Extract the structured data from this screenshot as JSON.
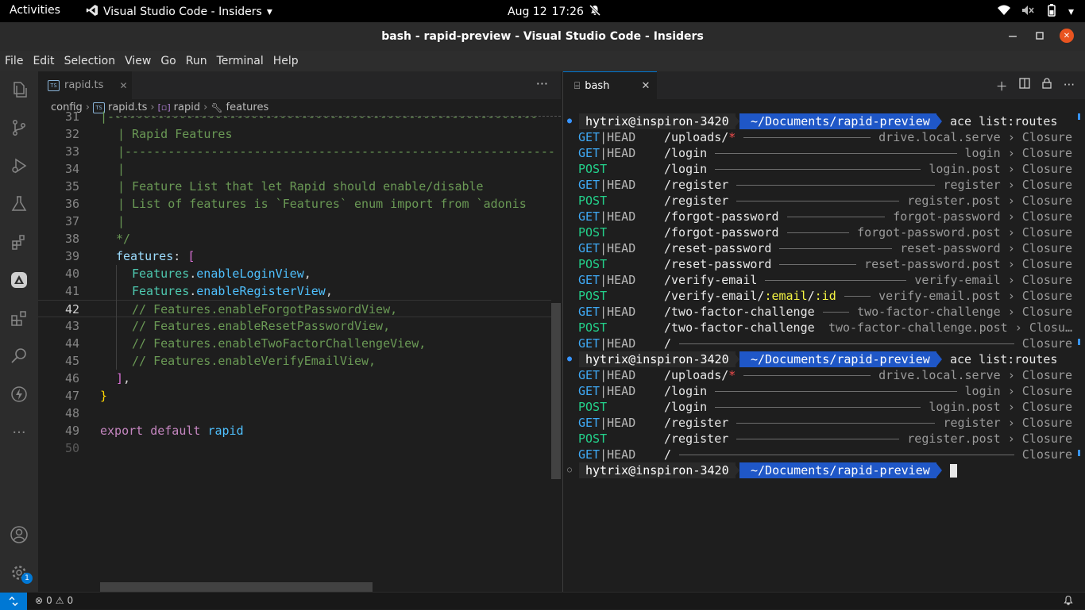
{
  "topbar": {
    "activities": "Activities",
    "app_name": "Visual Studio Code - Insiders",
    "date": "Aug 12",
    "time": "17:26"
  },
  "window": {
    "title": "bash - rapid-preview - Visual Studio Code - Insiders"
  },
  "menu": [
    "File",
    "Edit",
    "Selection",
    "View",
    "Go",
    "Run",
    "Terminal",
    "Help"
  ],
  "activitybar": {
    "icons": [
      "explorer-icon",
      "source-control-icon",
      "run-debug-icon",
      "testing-icon",
      "extensions-icon",
      "adonis-icon",
      "remote-explorer-icon",
      "search-icon",
      "thunder-icon",
      "more-icon"
    ],
    "accounts_icon": "account-icon",
    "settings_badge": "1"
  },
  "editor": {
    "tab_label": "rapid.ts",
    "breadcrumb": [
      "config",
      "rapid.ts",
      "rapid",
      "features"
    ],
    "lines": [
      {
        "n": "31",
        "text": ""
      },
      {
        "n": "32",
        "text": "| Rapid Features"
      },
      {
        "n": "33",
        "text": "|------------------------------------------------------------"
      },
      {
        "n": "34",
        "text": "|"
      },
      {
        "n": "35",
        "text": "| Feature List that let Rapid should enable/disable"
      },
      {
        "n": "36",
        "text": "| List of features is `Features` enum import from `adonis"
      },
      {
        "n": "37",
        "text": "|"
      },
      {
        "n": "38",
        "text": "*/"
      },
      {
        "n": "39",
        "text": ""
      },
      {
        "n": "40",
        "text": ""
      },
      {
        "n": "41",
        "text": ""
      },
      {
        "n": "42",
        "text": "// Features.enableForgotPasswordView,"
      },
      {
        "n": "43",
        "text": "// Features.enableResetPasswordView,"
      },
      {
        "n": "44",
        "text": "// Features.enableTwoFactorChallengeView,"
      },
      {
        "n": "45",
        "text": "// Features.enableVerifyEmailView,"
      },
      {
        "n": "46",
        "text": ""
      },
      {
        "n": "47",
        "text": "}"
      },
      {
        "n": "48",
        "text": ""
      },
      {
        "n": "49",
        "text": ""
      },
      {
        "n": "50",
        "text": ""
      }
    ],
    "tokens": {
      "features_key": "features",
      "colon": ":",
      "open_bracket": "[",
      "close_bracket": "]",
      "comma": ",",
      "cls": "Features",
      "dot": ".",
      "fn_login": "enableLoginView",
      "fn_register": "enableRegisterView",
      "export_kw": "export default",
      "export_var": "rapid"
    }
  },
  "terminal": {
    "tab_label": "bash",
    "user_host": "hytrix@inspiron-3420",
    "cwd": "~/Documents/rapid-preview",
    "command": "ace list:routes",
    "routes_a": [
      {
        "m1": "GET",
        "m2": "HEAD",
        "path": "/uploads/",
        "star": "*",
        "handler": "drive.local.serve",
        "arrow": " › ",
        "closure": "Closure"
      },
      {
        "m1": "GET",
        "m2": "HEAD",
        "path": "/login",
        "handler": "login",
        "arrow": " › ",
        "closure": "Closure"
      },
      {
        "m1": "POST",
        "m2": "",
        "path": "/login",
        "handler": "login.post",
        "arrow": " › ",
        "closure": "Closure"
      },
      {
        "m1": "GET",
        "m2": "HEAD",
        "path": "/register",
        "handler": "register",
        "arrow": " › ",
        "closure": "Closure"
      },
      {
        "m1": "POST",
        "m2": "",
        "path": "/register",
        "handler": "register.post",
        "arrow": " › ",
        "closure": "Closure"
      },
      {
        "m1": "GET",
        "m2": "HEAD",
        "path": "/forgot-password",
        "handler": "forgot-password",
        "arrow": " › ",
        "closure": "Closure"
      },
      {
        "m1": "POST",
        "m2": "",
        "path": "/forgot-password",
        "handler": "forgot-password.post",
        "arrow": " › ",
        "closure": "Closure"
      },
      {
        "m1": "GET",
        "m2": "HEAD",
        "path": "/reset-password",
        "handler": "reset-password",
        "arrow": " › ",
        "closure": "Closure"
      },
      {
        "m1": "POST",
        "m2": "",
        "path": "/reset-password",
        "handler": "reset-password.post",
        "arrow": " › ",
        "closure": "Closure"
      },
      {
        "m1": "GET",
        "m2": "HEAD",
        "path": "/verify-email",
        "handler": "verify-email",
        "arrow": " › ",
        "closure": "Closure"
      },
      {
        "m1": "POST",
        "m2": "",
        "path": "/verify-email/",
        "p1": ":email",
        "slash": "/",
        "p2": ":id",
        "handler": "verify-email.post",
        "arrow": " › ",
        "closure": "Closure"
      },
      {
        "m1": "GET",
        "m2": "HEAD",
        "path": "/two-factor-challenge",
        "handler": "two-factor-challenge",
        "arrow": " › ",
        "closure": "Closure"
      },
      {
        "m1": "POST",
        "m2": "",
        "path": "/two-factor-challenge",
        "handler": "two-factor-challenge.post",
        "arrow": " › ",
        "closure": "Closu…"
      },
      {
        "m1": "GET",
        "m2": "HEAD",
        "path": "/",
        "handler": "",
        "arrow": "",
        "closure": "Closure"
      }
    ],
    "routes_b": [
      {
        "m1": "GET",
        "m2": "HEAD",
        "path": "/uploads/",
        "star": "*",
        "handler": "drive.local.serve",
        "arrow": " › ",
        "closure": "Closure"
      },
      {
        "m1": "GET",
        "m2": "HEAD",
        "path": "/login",
        "handler": "login",
        "arrow": " › ",
        "closure": "Closure"
      },
      {
        "m1": "POST",
        "m2": "",
        "path": "/login",
        "handler": "login.post",
        "arrow": " › ",
        "closure": "Closure"
      },
      {
        "m1": "GET",
        "m2": "HEAD",
        "path": "/register",
        "handler": "register",
        "arrow": " › ",
        "closure": "Closure"
      },
      {
        "m1": "POST",
        "m2": "",
        "path": "/register",
        "handler": "register.post",
        "arrow": " › ",
        "closure": "Closure"
      },
      {
        "m1": "GET",
        "m2": "HEAD",
        "path": "/",
        "handler": "",
        "arrow": "",
        "closure": "Closure"
      }
    ]
  },
  "statusbar": {
    "errors": "0",
    "warnings": "0"
  },
  "colors": {
    "accent": "#0078d4",
    "prompt_path_bg": "#1f57c7",
    "get": "#3fa9f5",
    "post": "#23d18b",
    "param": "#f5f543"
  }
}
